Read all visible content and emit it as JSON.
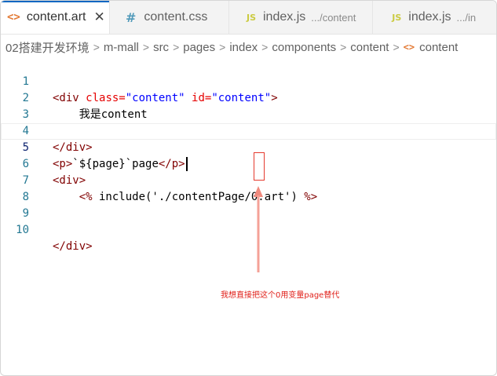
{
  "tabs": [
    {
      "icon": "html-file-icon",
      "icon_text": "<>",
      "name": "content.art",
      "desc": "",
      "active": true,
      "close": "✕"
    },
    {
      "icon": "css-file-icon",
      "icon_text": "#",
      "name": "content.css",
      "desc": ""
    },
    {
      "icon": "js-file-icon",
      "icon_text": "JS",
      "name": "index.js",
      "desc": ".../content"
    },
    {
      "icon": "js-file-icon",
      "icon_text": "JS",
      "name": "index.js",
      "desc": ".../in"
    }
  ],
  "breadcrumb": [
    "02搭建开发环境",
    "m-mall",
    "src",
    "pages",
    "index",
    "components",
    "content",
    "content"
  ],
  "breadcrumb_icon": "<>",
  "editor": {
    "line_numbers": [
      "1",
      "2",
      "3",
      "4",
      "5",
      "6",
      "7",
      "8",
      "9",
      "10"
    ],
    "lines": {
      "l1": {
        "tag_open": "<div ",
        "attr1": "class=",
        "val1": "\"content\"",
        "sp": " ",
        "attr2": "id=",
        "val2": "\"content\"",
        "tag_close": ">"
      },
      "l2": {
        "text": "    我是content"
      },
      "l4": {
        "tag": "</div>"
      },
      "l5": {
        "p_open": "<p>",
        "text": "`${page}`page",
        "p_close": "</p>"
      },
      "l6": {
        "tag": "<div>"
      },
      "l7": {
        "indent": "    ",
        "tpl_open": "<%",
        "text": " include('./contentPage/0.art') ",
        "tpl_close": "%>"
      },
      "l10": {
        "tag": "</div>"
      }
    }
  },
  "annotation": {
    "note": "我想直接把这个0用变量page替代",
    "color": "#e0201a"
  }
}
